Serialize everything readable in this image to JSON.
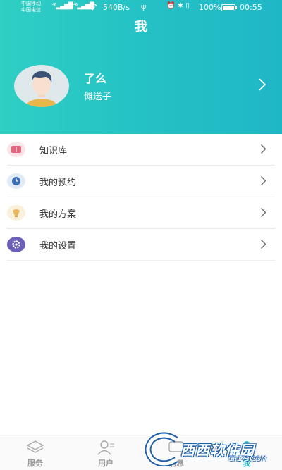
{
  "status_bar": {
    "carrier_1": "中国移动",
    "carrier_2": "中国电信",
    "net_speed": "540B/s",
    "battery_percent": "100%",
    "battery_level": 1.0,
    "time": "00:55"
  },
  "header": {
    "title": "我",
    "user_name": "了么",
    "user_subtitle": "傩送子"
  },
  "menu": [
    {
      "label": "知识库",
      "icon": "book-icon",
      "color": "#e0667c"
    },
    {
      "label": "我的预约",
      "icon": "clock-icon",
      "color": "#3b6fb6"
    },
    {
      "label": "我的方案",
      "icon": "plan-icon",
      "color": "#e8b75b"
    },
    {
      "label": "我的设置",
      "icon": "gear-icon",
      "color": "#6b5fb8"
    }
  ],
  "tabs": [
    {
      "label": "服务",
      "icon": "layers-icon"
    },
    {
      "label": "用户",
      "icon": "user-list-icon"
    },
    {
      "label": "消息",
      "icon": "message-icon"
    },
    {
      "label": "我",
      "icon": "me-icon"
    }
  ],
  "active_tab": 3,
  "colors": {
    "accent": "#2bbcc4",
    "header_start": "#2fcfc4",
    "header_end": "#1fb7c6"
  },
  "watermark": {
    "text": "西西软件园",
    "sub": "CR173.COM"
  }
}
